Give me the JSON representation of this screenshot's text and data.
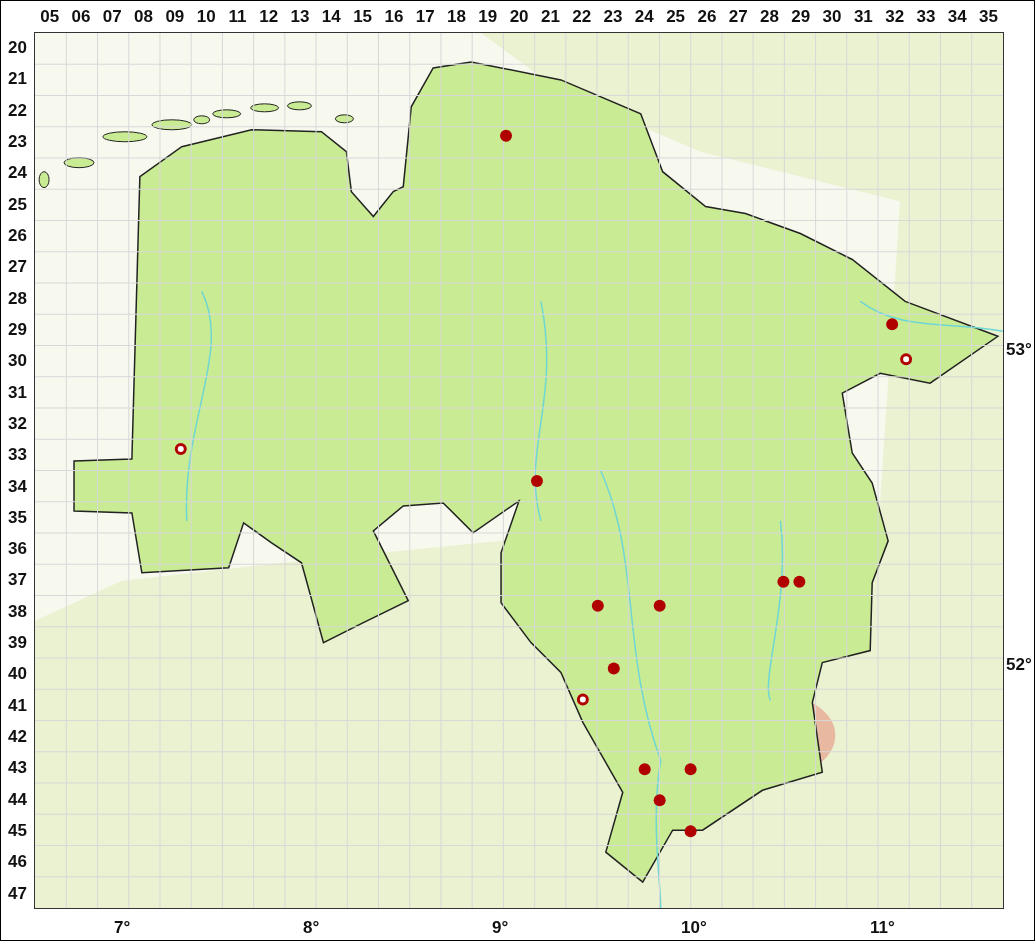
{
  "grid": {
    "columns": [
      "05",
      "06",
      "07",
      "08",
      "09",
      "10",
      "11",
      "12",
      "13",
      "14",
      "15",
      "16",
      "17",
      "18",
      "19",
      "20",
      "21",
      "22",
      "23",
      "24",
      "25",
      "26",
      "27",
      "28",
      "29",
      "30",
      "31",
      "32",
      "33",
      "34",
      "35"
    ],
    "rows": [
      "20",
      "21",
      "22",
      "23",
      "24",
      "25",
      "26",
      "27",
      "28",
      "29",
      "30",
      "31",
      "32",
      "33",
      "34",
      "35",
      "36",
      "37",
      "38",
      "39",
      "40",
      "41",
      "42",
      "43",
      "44",
      "45",
      "46",
      "47"
    ]
  },
  "longitude_labels": [
    "7°",
    "8°",
    "9°",
    "10°",
    "11°"
  ],
  "latitude_labels": [
    "53°",
    "52°"
  ],
  "records": [
    {
      "kind": "filled"
    },
    {
      "kind": "filled"
    },
    {
      "kind": "open"
    },
    {
      "kind": "open"
    },
    {
      "kind": "filled"
    },
    {
      "kind": "filled"
    },
    {
      "kind": "filled"
    },
    {
      "kind": "filled"
    },
    {
      "kind": "filled"
    },
    {
      "kind": "filled"
    },
    {
      "kind": "open"
    },
    {
      "kind": "filled"
    },
    {
      "kind": "filled"
    },
    {
      "kind": "filled"
    },
    {
      "kind": "filled"
    }
  ]
}
